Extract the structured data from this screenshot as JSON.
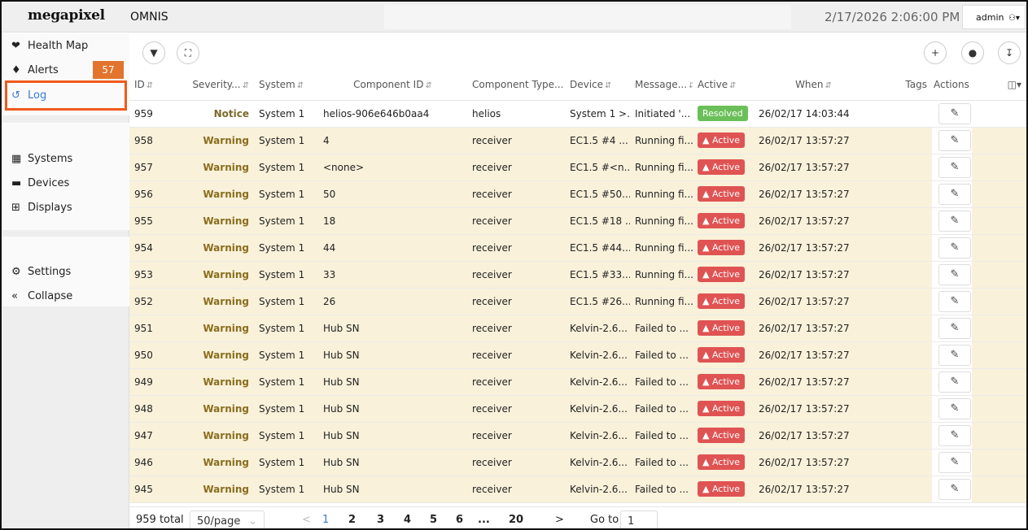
{
  "header": {
    "logo": "megapixel",
    "app_name": "OMNIS",
    "datetime": "2/17/2026 2:06:00 PM",
    "user": "admin",
    "user_icon": "user-dropdown-icon"
  },
  "sidebar": {
    "items": [
      {
        "label": "Health Map",
        "icon": "heart-pulse-icon"
      },
      {
        "label": "Alerts",
        "icon": "bell-icon",
        "badge": "57"
      },
      {
        "label": "Log",
        "icon": "history-icon",
        "active": true
      },
      {
        "label": "Systems",
        "icon": "network-icon"
      },
      {
        "label": "Devices",
        "icon": "device-icon"
      },
      {
        "label": "Displays",
        "icon": "grid-icon"
      },
      {
        "label": "Settings",
        "icon": "gears-icon"
      },
      {
        "label": "Collapse",
        "icon": "double-chevron-left-icon"
      }
    ]
  },
  "toolbar": {
    "left_icons": [
      "filter-icon",
      "expand-icon"
    ],
    "right_icons": [
      "plus-icon",
      "tag-icon",
      "download-icon"
    ]
  },
  "table": {
    "columns": [
      "ID",
      "Severity...",
      "System",
      "Component ID",
      "Component Type...",
      "Device",
      "Message...",
      "Active",
      "When",
      "Tags",
      "Actions"
    ],
    "rows": [
      {
        "id": "959",
        "severity": "Notice",
        "system": "System 1",
        "component_id": "helios-906e646b0aa4",
        "component_type": "helios",
        "device": "System 1 >...",
        "message": "Initiated '...",
        "active": "Resolved",
        "when": "26/02/17 14:03:44"
      },
      {
        "id": "958",
        "severity": "Warning",
        "system": "System 1",
        "component_id": "4",
        "component_type": "receiver",
        "device": "EC1.5 #4 ...",
        "message": "Running fi...",
        "active": "Active",
        "when": "26/02/17 13:57:27"
      },
      {
        "id": "957",
        "severity": "Warning",
        "system": "System 1",
        "component_id": "<none>",
        "component_type": "receiver",
        "device": "EC1.5 #<n...",
        "message": "Running fi...",
        "active": "Active",
        "when": "26/02/17 13:57:27"
      },
      {
        "id": "956",
        "severity": "Warning",
        "system": "System 1",
        "component_id": "50",
        "component_type": "receiver",
        "device": "EC1.5 #50...",
        "message": "Running fi...",
        "active": "Active",
        "when": "26/02/17 13:57:27"
      },
      {
        "id": "955",
        "severity": "Warning",
        "system": "System 1",
        "component_id": "18",
        "component_type": "receiver",
        "device": "EC1.5 #18 ...",
        "message": "Running fi...",
        "active": "Active",
        "when": "26/02/17 13:57:27"
      },
      {
        "id": "954",
        "severity": "Warning",
        "system": "System 1",
        "component_id": "44",
        "component_type": "receiver",
        "device": "EC1.5 #44...",
        "message": "Running fi...",
        "active": "Active",
        "when": "26/02/17 13:57:27"
      },
      {
        "id": "953",
        "severity": "Warning",
        "system": "System 1",
        "component_id": "33",
        "component_type": "receiver",
        "device": "EC1.5 #33...",
        "message": "Running fi...",
        "active": "Active",
        "when": "26/02/17 13:57:27"
      },
      {
        "id": "952",
        "severity": "Warning",
        "system": "System 1",
        "component_id": "26",
        "component_type": "receiver",
        "device": "EC1.5 #26...",
        "message": "Running fi...",
        "active": "Active",
        "when": "26/02/17 13:57:27"
      },
      {
        "id": "951",
        "severity": "Warning",
        "system": "System 1",
        "component_id": "Hub SN",
        "component_type": "receiver",
        "device": "Kelvin-2.6...",
        "message": "Failed to ...",
        "active": "Active",
        "when": "26/02/17 13:57:27"
      },
      {
        "id": "950",
        "severity": "Warning",
        "system": "System 1",
        "component_id": "Hub SN",
        "component_type": "receiver",
        "device": "Kelvin-2.6...",
        "message": "Failed to ...",
        "active": "Active",
        "when": "26/02/17 13:57:27"
      },
      {
        "id": "949",
        "severity": "Warning",
        "system": "System 1",
        "component_id": "Hub SN",
        "component_type": "receiver",
        "device": "Kelvin-2.6...",
        "message": "Failed to ...",
        "active": "Active",
        "when": "26/02/17 13:57:27"
      },
      {
        "id": "948",
        "severity": "Warning",
        "system": "System 1",
        "component_id": "Hub SN",
        "component_type": "receiver",
        "device": "Kelvin-2.6...",
        "message": "Failed to ...",
        "active": "Active",
        "when": "26/02/17 13:57:27"
      },
      {
        "id": "947",
        "severity": "Warning",
        "system": "System 1",
        "component_id": "Hub SN",
        "component_type": "receiver",
        "device": "Kelvin-2.6...",
        "message": "Failed to ...",
        "active": "Active",
        "when": "26/02/17 13:57:27"
      },
      {
        "id": "946",
        "severity": "Warning",
        "system": "System 1",
        "component_id": "Hub SN",
        "component_type": "receiver",
        "device": "Kelvin-2.6...",
        "message": "Failed to ...",
        "active": "Active",
        "when": "26/02/17 13:57:27"
      },
      {
        "id": "945",
        "severity": "Warning",
        "system": "System 1",
        "component_id": "Hub SN",
        "component_type": "receiver",
        "device": "Kelvin-2.6...",
        "message": "Failed to ...",
        "active": "Active",
        "when": "26/02/17 13:57:27"
      }
    ]
  },
  "pagination": {
    "total": "959 total",
    "page_size": "50/page",
    "prev": "<",
    "next": ">",
    "pages": [
      "1",
      "2",
      "3",
      "4",
      "5",
      "6",
      "...",
      "20"
    ],
    "current": "1",
    "goto_label": "Go to",
    "goto_value": "1"
  },
  "colors": {
    "accent": "#3a7bd5",
    "warning_row": "#f9f1da",
    "active_pill": "#e05353",
    "resolved_pill": "#6bbf59",
    "alert_badge": "#e2742e",
    "highlight": "#f05a1a"
  }
}
